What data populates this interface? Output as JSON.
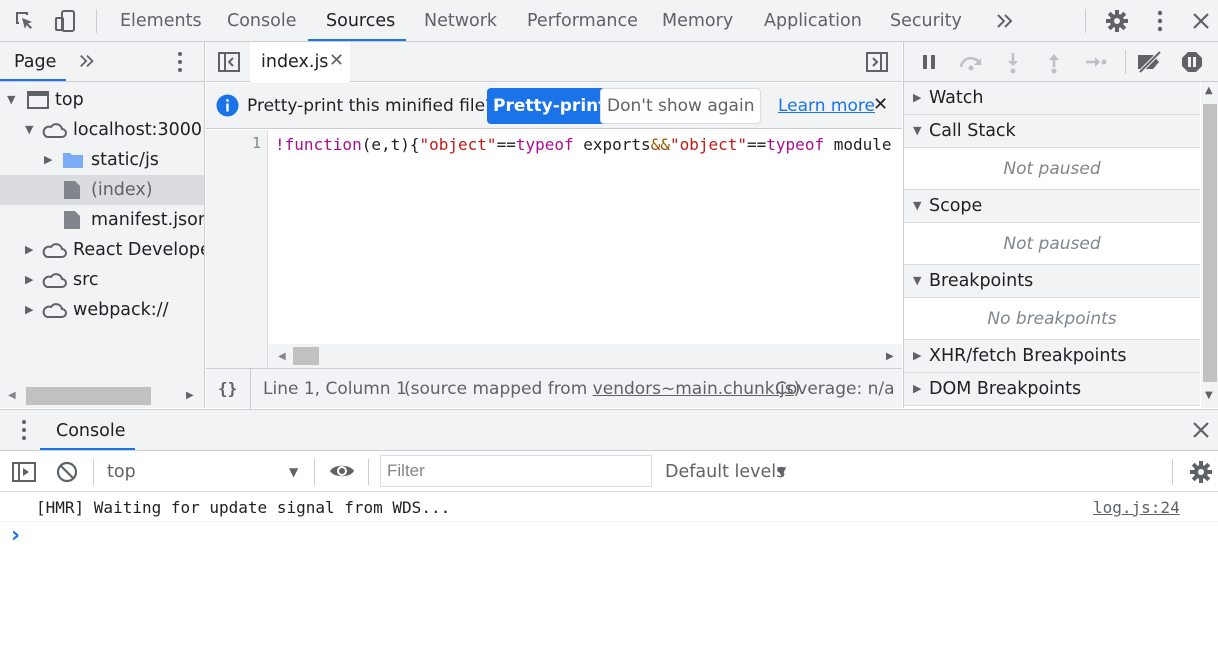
{
  "main_tabs": [
    "Elements",
    "Console",
    "Sources",
    "Network",
    "Performance",
    "Memory",
    "Application",
    "Security"
  ],
  "active_tab": "Sources",
  "navigator": {
    "tab_label": "Page",
    "tree": [
      {
        "label": "top",
        "icon": "frame-icon",
        "expanded": true
      },
      {
        "label": "localhost:3000",
        "icon": "cloud-icon",
        "expanded": true
      },
      {
        "label": "static/js",
        "icon": "folder-icon",
        "expanded": false
      },
      {
        "label": "(index)",
        "icon": "file-icon",
        "selected": true
      },
      {
        "label": "manifest.json",
        "icon": "file-icon"
      },
      {
        "label": "React Developer Tools",
        "icon": "cloud-icon",
        "expanded": false
      },
      {
        "label": "src",
        "icon": "cloud-icon",
        "expanded": false
      },
      {
        "label": "webpack://",
        "icon": "cloud-icon",
        "expanded": false
      }
    ]
  },
  "editor": {
    "open_file": "index.js",
    "infobar": {
      "message": "Pretty-print this minified file?",
      "primary_button": "Pretty-print",
      "secondary_button": "Don't show again",
      "link": "Learn more"
    },
    "line_number": "1",
    "code_tokens": [
      {
        "t": "!function",
        "c": "tok-kw"
      },
      {
        "t": "(e,t){",
        "c": "tok-plain"
      },
      {
        "t": "\"object\"",
        "c": "tok-str"
      },
      {
        "t": "==",
        "c": "tok-plain"
      },
      {
        "t": "typeof",
        "c": "tok-kw"
      },
      {
        "t": " exports",
        "c": "tok-plain"
      },
      {
        "t": "&&",
        "c": "tok-op"
      },
      {
        "t": "\"object\"",
        "c": "tok-str"
      },
      {
        "t": "==",
        "c": "tok-plain"
      },
      {
        "t": "typeof",
        "c": "tok-kw"
      },
      {
        "t": " module",
        "c": "tok-plain"
      }
    ],
    "status": {
      "format_icon": "{}",
      "position": "Line 1, Column 1",
      "source_prefix": "(source mapped from ",
      "source_file": "vendors~main.chunk.js",
      "source_suffix": ")",
      "coverage": "Coverage: n/a"
    }
  },
  "debugger": {
    "panes": [
      {
        "label": "Watch",
        "expanded": false
      },
      {
        "label": "Call Stack",
        "expanded": true,
        "body": "Not paused"
      },
      {
        "label": "Scope",
        "expanded": true,
        "body": "Not paused"
      },
      {
        "label": "Breakpoints",
        "expanded": true,
        "body": "No breakpoints"
      },
      {
        "label": "XHR/fetch Breakpoints",
        "expanded": false
      },
      {
        "label": "DOM Breakpoints",
        "expanded": false
      }
    ]
  },
  "drawer": {
    "tab_label": "Console",
    "context": "top",
    "filter_placeholder": "Filter",
    "levels": "Default levels",
    "messages": [
      {
        "text": "[HMR] Waiting for update signal from WDS...",
        "source": "log.js:24"
      }
    ],
    "prompt": "›"
  },
  "colors": {
    "accent": "#1a73e8",
    "toolbar_bg": "#f1f3f4",
    "border": "#cacdd1"
  }
}
